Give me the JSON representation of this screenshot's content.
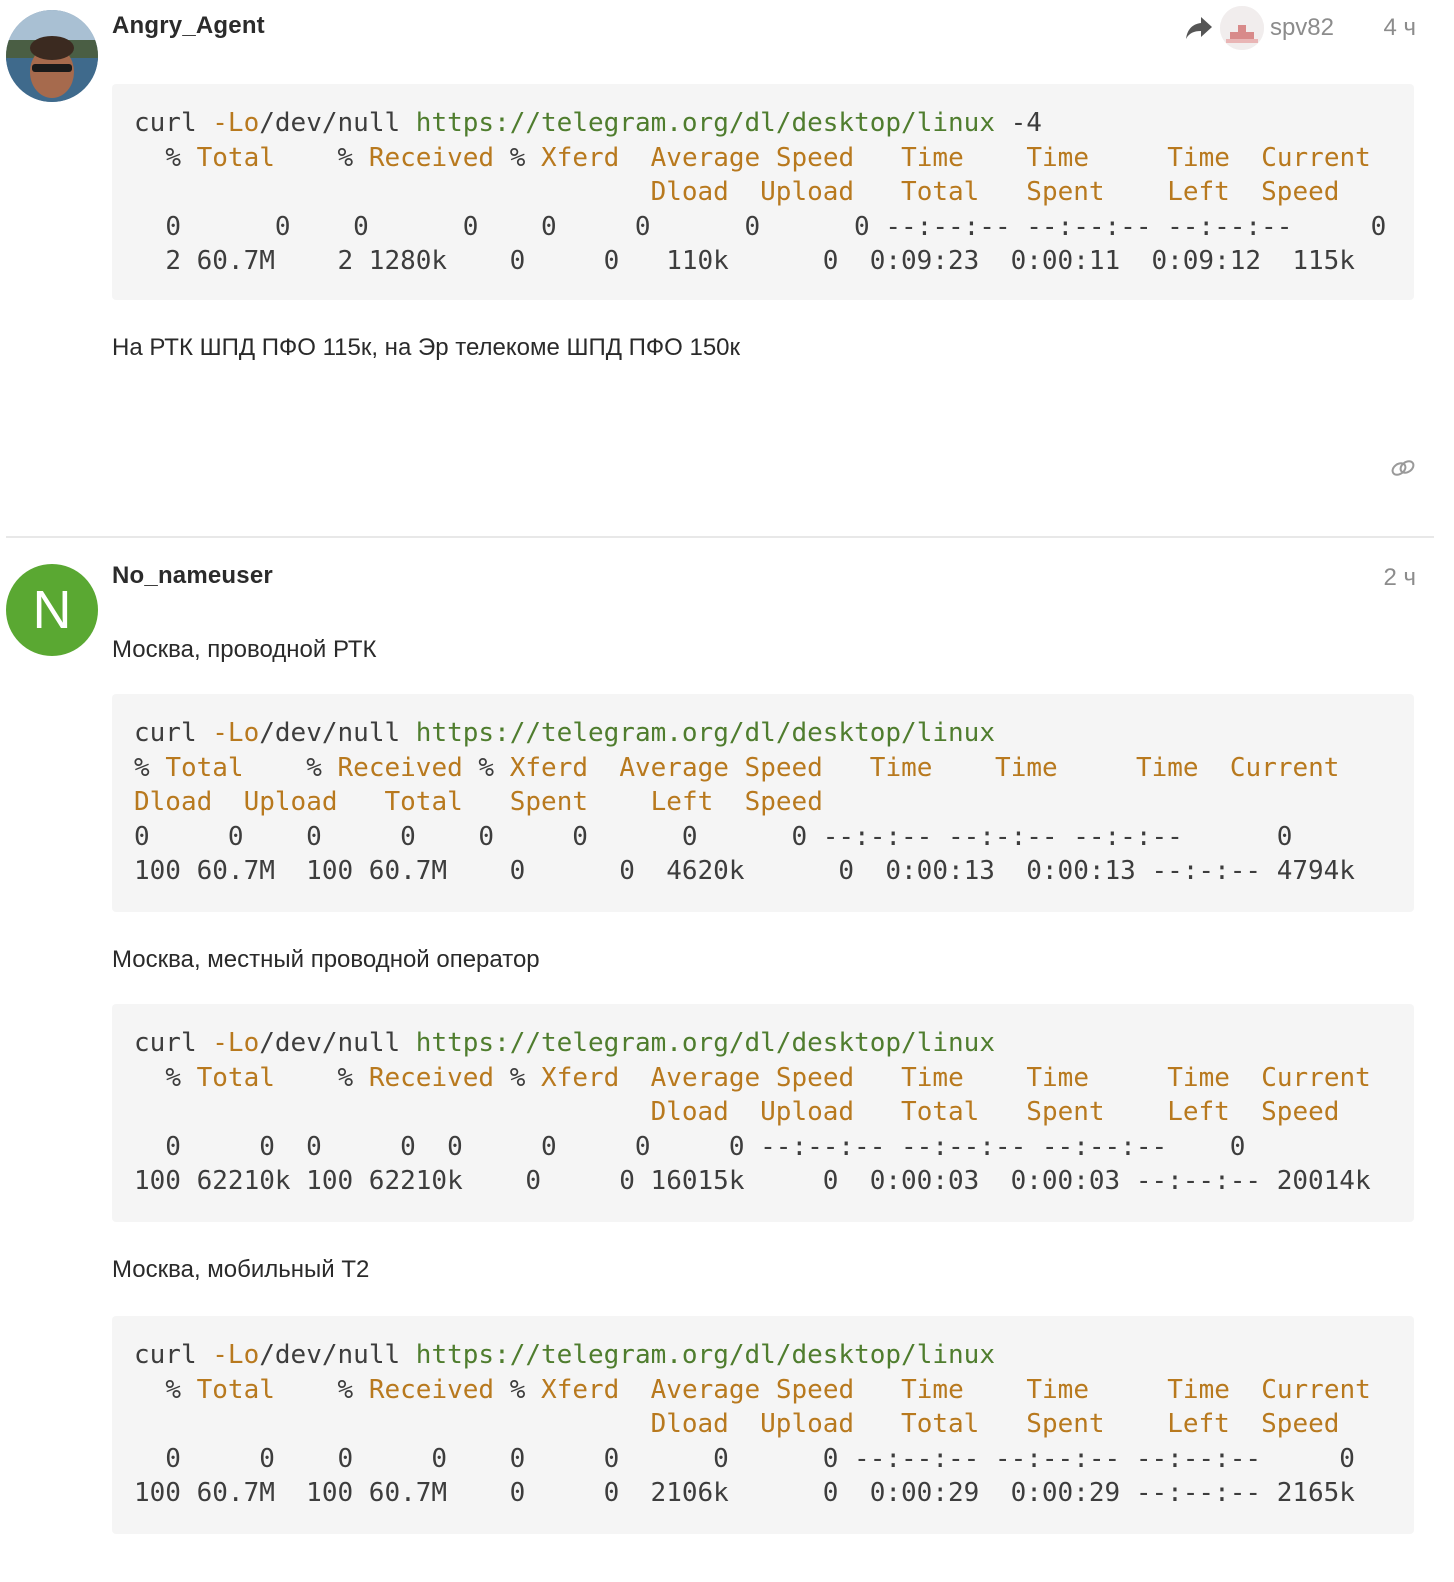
{
  "post1": {
    "username": "Angry_Agent",
    "reply_to": "spv82",
    "time": "4 ч",
    "code": {
      "cmd_prefix": "curl ",
      "cmd_flag": "-Lo",
      "cmd_path": "/dev/null ",
      "cmd_url": "https://telegram.org/dl/desktop/linux",
      "cmd_suffix": " -4",
      "rows": [
        "0      0    0      0    0     0      0      0 --:--:-- --:--:-- --:--:--     0",
        "2 60.7M    2 1280k    0     0   110k      0  0:09:23  0:00:11  0:09:12  115k"
      ]
    },
    "text": "На РТК ШПД ПФО 115к, на Эр телекоме ШПД ПФО 150к"
  },
  "post2": {
    "username": "No_nameuser",
    "avatar_letter": "N",
    "time": "2 ч",
    "sections": [
      {
        "label": "Москва, проводной РТК",
        "rows": [
          "0     0    0     0    0     0      0      0 --:-:-- --:-:-- --:-:--      0",
          "100 60.7M  100 60.7M    0      0  4620k      0  0:00:13  0:00:13 --:-:-- 4794k"
        ]
      },
      {
        "label": "Москва, местный проводной оператор",
        "rows": [
          "  0     0  0     0  0     0     0     0 --:--:-- --:--:-- --:--:--    0",
          "100 62210k 100 62210k    0     0 16015k     0  0:00:03  0:00:03 --:--:-- 20014k"
        ]
      },
      {
        "label": "Москва, мобильный Т2",
        "rows": [
          "  0     0    0     0    0     0      0      0 --:--:-- --:--:-- --:--:--     0",
          "100 60.7M  100 60.7M    0     0  2106k      0  0:00:29  0:00:29 --:--:-- 2165k"
        ]
      }
    ]
  },
  "curl_header": {
    "h_pct": "% ",
    "h_total": "Total",
    "h_recv": "Received",
    "h_xferd": "Xferd",
    "h_avg_speed": "Average Speed",
    "h_time": "Time",
    "h_current": "Current",
    "h_dload": "Dload",
    "h_upload": "Upload",
    "h_total2": "Total",
    "h_spent": "Spent",
    "h_left": "Left",
    "h_speed": "Speed"
  },
  "icons": {
    "reply": "reply-arrow-icon",
    "link": "link-icon"
  },
  "colors": {
    "keyword": "#b8791e",
    "url": "#4f7d2e",
    "avatar_green": "#5aa832"
  }
}
